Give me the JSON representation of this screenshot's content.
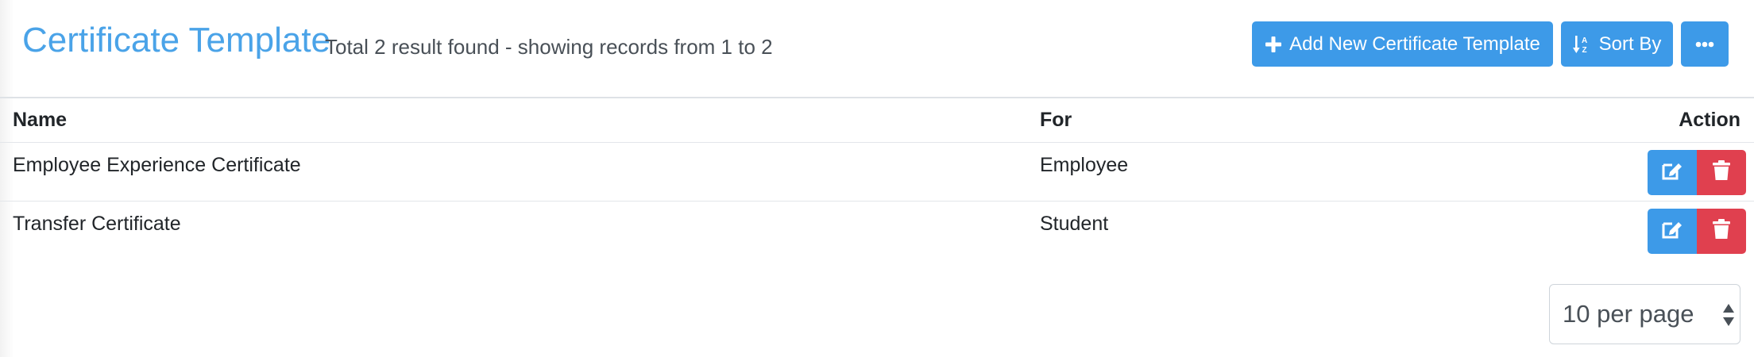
{
  "header": {
    "title": "Certificate Template",
    "summary": "Total 2 result found - showing records from 1 to 2",
    "add_button_label": "Add New Certificate Template",
    "sort_button_label": "Sort By",
    "more_icon": "ellipsis-icon"
  },
  "table": {
    "columns": [
      "Name",
      "For",
      "Action"
    ],
    "rows": [
      {
        "name": "Employee Experience Certificate",
        "for": "Employee"
      },
      {
        "name": "Transfer Certificate",
        "for": "Student"
      }
    ]
  },
  "pagination": {
    "per_page_selected": "10 per page"
  },
  "colors": {
    "primary": "#3d9ae8",
    "title": "#4aa3e8",
    "danger": "#e0404f"
  }
}
